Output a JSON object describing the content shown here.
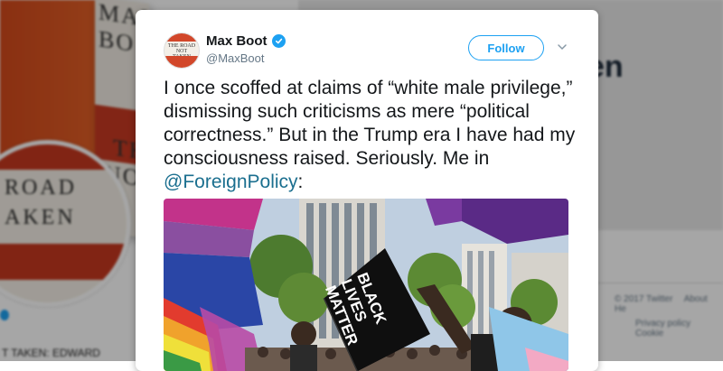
{
  "background": {
    "book_lines": [
      "MAX BO",
      "TH",
      "NO"
    ],
    "avatar_lines": [
      "ROAD",
      "AKEN"
    ],
    "profile_name_fragment": "en",
    "bottom_left_text": "T TAKEN: EDWARD",
    "footer": {
      "row1": [
        "© 2017 Twitter",
        "About",
        "He"
      ],
      "row2": [
        "Privacy policy",
        "Cookie"
      ]
    }
  },
  "tweet": {
    "avatar_text": "THE ROAD NOT TAKEN",
    "display_name": "Max Boot",
    "handle": "@MaxBoot",
    "follow_label": "Follow",
    "text_plain": "I once scoffed at claims of “white male privilege,” dismissing such criticisms as mere “political correctness.” But in the Trump era I have had my consciousness raised. Seriously. Me in ",
    "text_mention": "@ForeignPolicy",
    "text_end": ":",
    "photo": {
      "sign_lines": [
        "BLACK",
        "LIVES",
        "MATTER"
      ]
    }
  },
  "colors": {
    "accent": "#1da1f2",
    "mention": "#1b6f8f",
    "text": "#14171a",
    "secondary": "#657786"
  },
  "icons": {
    "verified": "verified-badge-icon",
    "menu": "chevron-down-icon"
  }
}
